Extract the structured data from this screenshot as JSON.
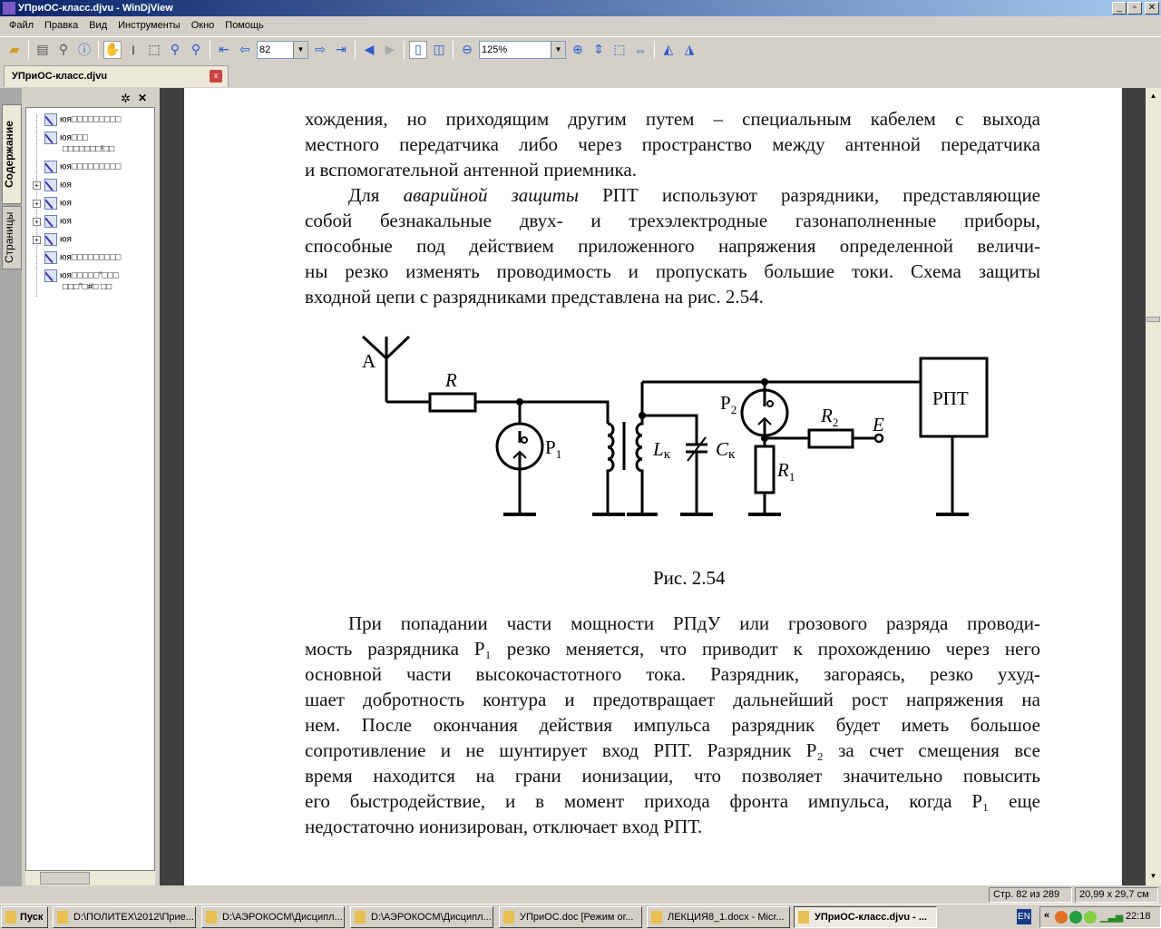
{
  "window": {
    "title": "УПриОС-класс.djvu - WinDjView",
    "min": "_",
    "max": "▫",
    "close": "✕"
  },
  "menu": [
    "Файл",
    "Правка",
    "Вид",
    "Инструменты",
    "Окно",
    "Помощь"
  ],
  "toolbar": {
    "page": "82",
    "zoom": "125%"
  },
  "tab": {
    "label": "УПриОС-класс.djvu",
    "close": "x"
  },
  "sidebar": {
    "tabs": [
      "Содержание",
      "Страницы"
    ],
    "gear": "✲",
    "close": "✕",
    "items": [
      {
        "label": "юя□□□□□□□□□",
        "plus": false
      },
      {
        "label": "юя□□□",
        "label2": "□□□□□□□!□□",
        "plus": false
      },
      {
        "label": "юя□□□□□□□□□",
        "plus": false
      },
      {
        "label": "юя",
        "plus": true
      },
      {
        "label": "юя",
        "plus": true
      },
      {
        "label": "юя",
        "plus": true
      },
      {
        "label": "юя",
        "plus": true
      },
      {
        "label": "юя□□□□□□□□□",
        "plus": false
      },
      {
        "label": "юя□□□□□\"□□□",
        "label2": "□□□\"□#□ □□",
        "plus": false
      }
    ]
  },
  "document": {
    "para1": [
      "хождения, но приходящим другим путем – специальным кабелем с выхода",
      "местного передатчика либо через пространство между антенной передатчика",
      "и вспомогательной антенной приемника."
    ],
    "para2": {
      "first_pre": "Для ",
      "first_italic": "аварийной защиты",
      "first_post": " РПТ используют разрядники, представляющие",
      "lines": [
        "собой безнакальные двух- и трехэлектродные газонаполненные приборы,",
        "способные под действием приложенного напряжения определенной величи-",
        "ны резко изменять проводимость и пропускать большие токи. Схема защиты",
        "входной цепи с разрядниками представлена на рис. 2.54."
      ]
    },
    "figure": {
      "caption": "Рис. 2.54",
      "labels": {
        "antenna": "A",
        "r": "R",
        "p1": "Р",
        "p1_sub": "1",
        "lk": "L",
        "lk_sub": "к",
        "ck": "C",
        "ck_sub": "к",
        "p2": "Р",
        "p2_sub": "2",
        "r2": "R",
        "r2_sub": "2",
        "e": "E",
        "r1": "R",
        "r1_sub": "1",
        "rpt": "РПТ"
      }
    },
    "para3": [
      "При попадании части мощности РПдУ или грозового разряда проводи-",
      "мость разрядника Р₁ резко меняется, что приводит к прохождению через него",
      "основной части высокочастотного тока. Разрядник, загораясь, резко ухуд-",
      "шает добротность контура и предотвращает дальнейший рост напряжения на",
      "нем. После окончания действия импульса разрядник будет иметь большое",
      "сопротивление и не шунтирует вход РПТ. Разрядник Р₂ за счет смещения все",
      "время находится на грани ионизации, что позволяет значительно повысить",
      "его быстродействие, и в момент прихода фронта импульса, когда Р₁ еще",
      "недостаточно ионизирован, отключает вход РПТ."
    ]
  },
  "status": {
    "page": "Стр. 82 из 289",
    "size": "20,99 x 29,7 см"
  },
  "taskbar": {
    "start": "Пуск",
    "tasks": [
      "D:\\ПОЛИТЕХ\\2012\\Прие...",
      "D:\\АЭРОКОСМ\\Дисципл...",
      "D:\\АЭРОКОСМ\\Дисципл...",
      "УПриОС.doc [Режим ог...",
      "ЛЕКЦИЯ8_1.docx - Micr...",
      "УПриОС-класс.djvu - ..."
    ],
    "lang": "EN",
    "clock": "22:18"
  }
}
